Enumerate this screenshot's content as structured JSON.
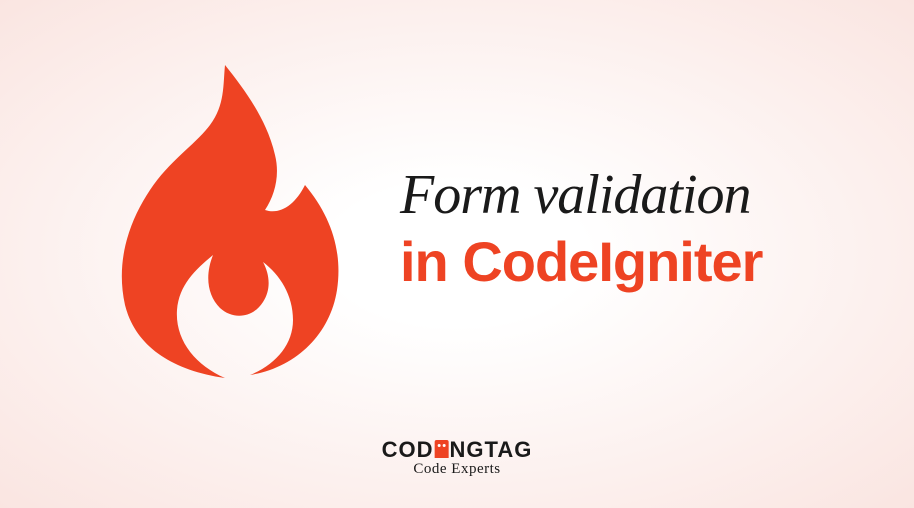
{
  "title": {
    "line1": "Form validation",
    "line2": "in CodeIgniter"
  },
  "logo": {
    "prefix": "COD",
    "suffix": "NGTAG",
    "tagline": "Code Experts"
  },
  "colors": {
    "accent": "#ee4323",
    "text": "#1a1a1a",
    "bg_inner": "#ffffff",
    "bg_outer": "#fae5e1"
  }
}
